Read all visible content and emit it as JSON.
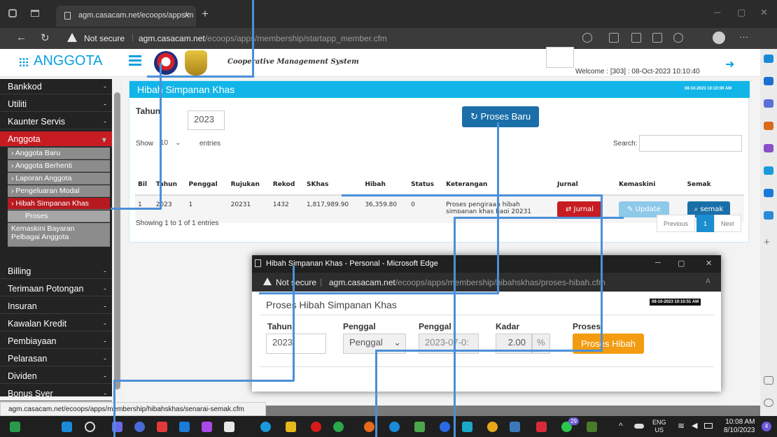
{
  "browser": {
    "tab_title": "agm.casacam.net/ecoops/apps/m",
    "tab_close": "✕",
    "new_tab": "+",
    "not_secure": "Not secure",
    "url_host": "agm.casacam.net",
    "url_path": "/ecoops/apps/membership/startapp_member.cfm"
  },
  "header": {
    "brand": "ANGGOTA",
    "system_title": "Cooperative Management System",
    "welcome": "Welcome : [303] : 08-Oct-2023 10:10:40"
  },
  "sidebar": {
    "items": [
      {
        "label": "Bankkod",
        "mark": "-"
      },
      {
        "label": "Utiliti",
        "mark": "-"
      },
      {
        "label": "Kaunter Servis",
        "mark": "-"
      },
      {
        "label": "Anggota",
        "mark": "▾"
      },
      {
        "label": "Billing",
        "mark": "-"
      },
      {
        "label": "Terimaan Potongan",
        "mark": "-"
      },
      {
        "label": "Insuran",
        "mark": "-"
      },
      {
        "label": "Kawalan Kredit",
        "mark": "-"
      },
      {
        "label": "Pembiayaan",
        "mark": "-"
      },
      {
        "label": "Pelarasan",
        "mark": "-"
      },
      {
        "label": "Dividen",
        "mark": "-"
      },
      {
        "label": "Bonus Syer",
        "mark": "-"
      }
    ],
    "subitems": [
      "Anggota Baru",
      "Anggota Berhenti",
      "Laporan Anggota",
      "Pengeluaran Modal",
      "Hibah Simpanan Khas"
    ],
    "sub_sub": "Proses",
    "last_sub_line1": "Kemaskini Bayaran",
    "last_sub_line2": "Pelbagai Anggota"
  },
  "panel": {
    "title": "Hibah Simpanan Khas",
    "stamp": "08-10-2023 10:10:00 AM",
    "tahun_label": "Tahun",
    "tahun_value": "2023",
    "proses_button": "Proses Baru",
    "show_label": "Show",
    "entries_value": "10",
    "entries_label": "entries",
    "search_label": "Search:",
    "columns": [
      "Bil",
      "Tahun",
      "Penggal",
      "Rujukan",
      "Rekod",
      "SKhas",
      "Hibah",
      "Status",
      "Keterangan",
      "Jurnal",
      "Kemaskini",
      "Semak"
    ],
    "row": {
      "bil": "1",
      "tahun": "2023",
      "penggal": "1",
      "rujukan": "20231",
      "rekod": "1432",
      "skhas": "1,817,989.90",
      "hibah": "36,359.80",
      "status": "0",
      "keterangan_line1": "Proses pengiraan hibah",
      "keterangan_line2": "simpanan khas bagi 20231",
      "jurnal": "Jurnal",
      "kemaskini": "Update",
      "semak": "semak"
    },
    "showing": "Showing 1 to 1 of 1 entries",
    "previous": "Previous",
    "page": "1",
    "next": "Next"
  },
  "popup": {
    "window_title": "Hibah Simpanan Khas - Personal - Microsoft Edge",
    "not_secure": "Not secure",
    "url_host": "agm.casacam.net",
    "url_path": "/ecoops/apps/membership/hibahskhas/proses-hibah.cfm",
    "heading": "Proses Hibah Simpanan Khas",
    "stamp": "08-10-2023 10:10:51 AM",
    "labels": {
      "tahun": "Tahun",
      "penggal": "Penggal",
      "penggal2": "Penggal",
      "kadar": "Kadar",
      "proses": "Proses"
    },
    "tahun_value": "2023",
    "penggal_select": "Penggal",
    "penggal_date": "2023-07-0:",
    "kadar_value": "2.00",
    "kadar_unit": "%",
    "proses_button": "Proses Hibah"
  },
  "statusbar": {
    "text": "agm.casacam.net/ecoops/apps/membership/hibahskhas/senarai-semak.cfm"
  },
  "taskbar": {
    "lang": "ENG",
    "region": "US",
    "time": "10:08 AM",
    "date": "8/10/2023",
    "badge1": "29",
    "badge2": "4"
  },
  "colors": {
    "accent": "#12b5e8",
    "active": "#c71c22",
    "primary_button": "#1b6fa8",
    "orange": "#f39c12"
  }
}
